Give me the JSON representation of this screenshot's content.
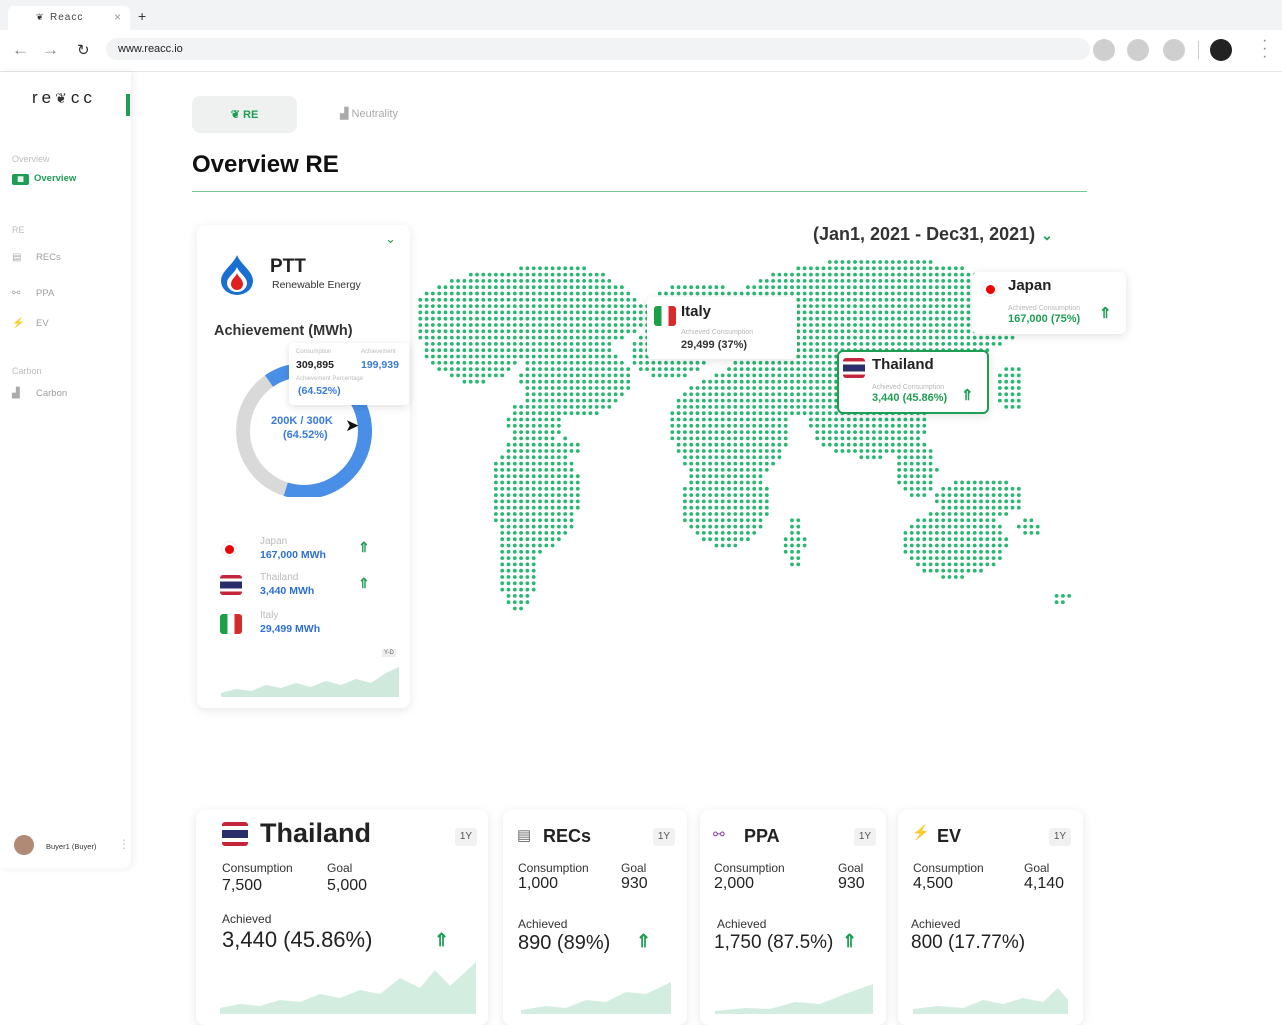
{
  "browser": {
    "tab_title": "Reacc",
    "tab_close": "×",
    "new_tab": "+",
    "url": "www.reacc.io"
  },
  "sidebar": {
    "logo": "re cc",
    "sections": [
      {
        "title": "Overview",
        "items": [
          {
            "label": "Overview",
            "icon": "dashboard-icon",
            "active": true
          }
        ]
      },
      {
        "title": "RE",
        "items": [
          {
            "label": "RECs",
            "icon": "certificate-icon"
          },
          {
            "label": "PPA",
            "icon": "handshake-icon"
          },
          {
            "label": "EV",
            "icon": "ev-charger-icon"
          }
        ]
      },
      {
        "title": "Carbon",
        "items": [
          {
            "label": "Carbon",
            "icon": "factory-icon"
          }
        ]
      }
    ],
    "user": "Buyer1 (Buyer)"
  },
  "tabs": {
    "re": "RE",
    "neutrality": "Neutrality"
  },
  "page_title": "Overview RE",
  "date_range": "(Jan1, 2021 - Dec31, 2021)",
  "company": {
    "name": "PTT",
    "subtitle": "Renewable Energy",
    "achievement_title": "Achievement (MWh)",
    "tooltip": {
      "consumption_label": "Consumption",
      "consumption_value": "309,895",
      "achievement_label": "Achievement",
      "achievement_value": "199,939",
      "pct_label": "Achievement Percentage",
      "pct_value": "(64.52%)"
    },
    "donut_center": "200K / 300K",
    "donut_pct": "(64.52%)",
    "donut_fraction": 0.6452,
    "countries": [
      {
        "name": "Japan",
        "value": "167,000 MWh"
      },
      {
        "name": "Thailand",
        "value": "3,440 MWh"
      },
      {
        "name": "Italy",
        "value": "29,499 MWh"
      }
    ],
    "spark_badge": "Y-D"
  },
  "map_tooltips": {
    "italy": {
      "name": "Italy",
      "label": "Achieved Consumption",
      "value": "29,499 (37%)"
    },
    "thailand": {
      "name": "Thailand",
      "label": "Achieved Consumption",
      "value": "3,440 (45.86%)"
    },
    "japan": {
      "name": "Japan",
      "label": "Achieved Consumption",
      "value": "167,000 (75%)"
    }
  },
  "cards": [
    {
      "title": "Thailand",
      "badge": "1Y",
      "consumption_label": "Consumption",
      "consumption": "7,500",
      "goal_label": "Goal",
      "goal": "5,000",
      "achieved_label": "Achieved",
      "achieved": "3,440 (45.86%)"
    },
    {
      "title": "RECs",
      "badge": "1Y",
      "consumption_label": "Consumption",
      "consumption": "1,000",
      "goal_label": "Goal",
      "goal": "930",
      "achieved_label": "Achieved",
      "achieved": "890 (89%)"
    },
    {
      "title": "PPA",
      "badge": "1Y",
      "consumption_label": "Consumption",
      "consumption": "2,000",
      "goal_label": "Goal",
      "goal": "930",
      "achieved_label": "Achieved",
      "achieved": "1,750 (87.5%)"
    },
    {
      "title": "EV",
      "badge": "1Y",
      "consumption_label": "Consumption",
      "consumption": "4,500",
      "goal_label": "Goal",
      "goal": "4,140",
      "achieved_label": "Achieved",
      "achieved": "800 (17.77%)"
    }
  ],
  "colors": {
    "accent": "#1e9e54",
    "map_dot": "#2bb673",
    "donut_fill": "#4a8fe7",
    "donut_track": "#d9d9d9",
    "spark": "#d4ede1"
  }
}
